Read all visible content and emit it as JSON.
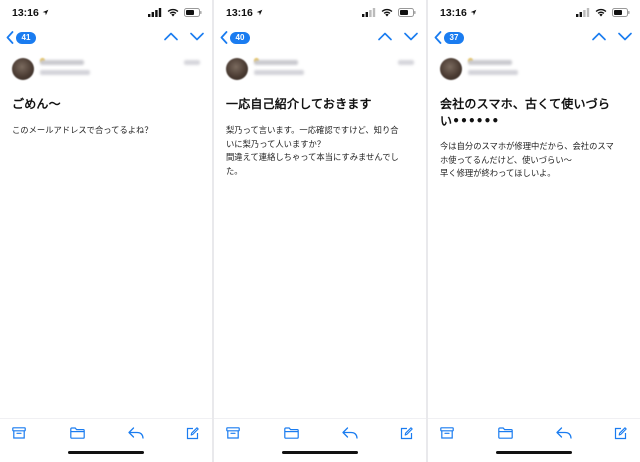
{
  "colors": {
    "accent": "#1a7cf0",
    "text": "#111111"
  },
  "screens": [
    {
      "status": {
        "time": "13:16"
      },
      "nav": {
        "message_count": "41"
      },
      "email": {
        "subject": "ごめん〜",
        "body": "このメールアドレスで合ってるよね？"
      }
    },
    {
      "status": {
        "time": "13:16"
      },
      "nav": {
        "message_count": "40"
      },
      "email": {
        "subject": "一応自己紹介しておきます",
        "body": "梨乃って言います。一応確認ですけど、知り合\nいに梨乃って人いますか？\n間違えて連絡しちゃって本当にすみませんでし\nた。"
      }
    },
    {
      "status": {
        "time": "13:16"
      },
      "nav": {
        "message_count": "37"
      },
      "email": {
        "subject": "会社のスマホ、古くて使いづら\nい••••••",
        "body": "今は自分のスマホが修理中だから、会社のスマ\nホ使ってるんだけど、使いづらい〜\n早く修理が終わってほしいよ。"
      }
    }
  ],
  "icons": {
    "status": [
      "location-arrow-icon",
      "cellular-signal-icon",
      "wifi-icon",
      "battery-icon"
    ],
    "nav": [
      "back-chevron-icon",
      "chevron-up-icon",
      "chevron-down-icon"
    ],
    "toolbar": [
      "archive-icon",
      "folder-icon",
      "reply-icon",
      "compose-icon"
    ]
  }
}
